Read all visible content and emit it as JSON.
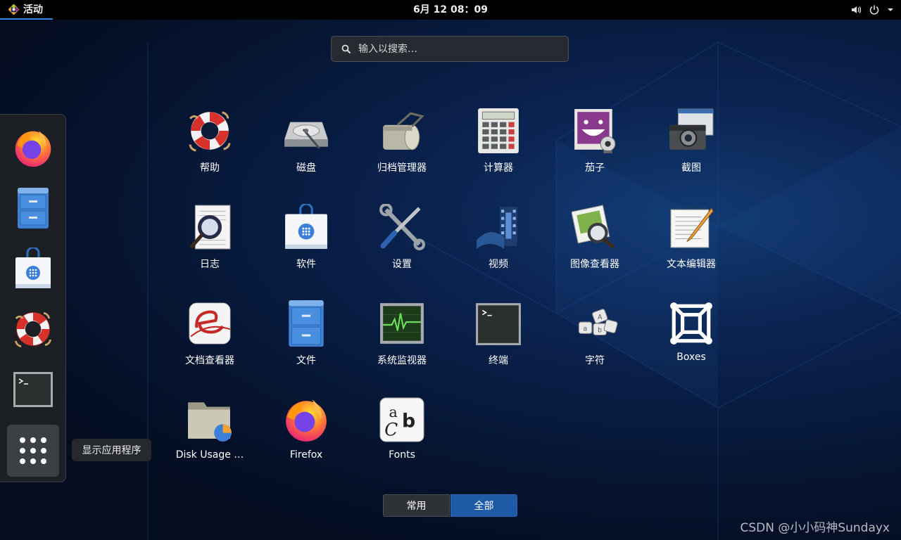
{
  "topbar": {
    "activities_label": "活动",
    "clock": "6月 12  08：09"
  },
  "search": {
    "placeholder": "输入以搜索…"
  },
  "dash": {
    "items": [
      "firefox-icon",
      "files-icon",
      "software-icon",
      "help-icon",
      "terminal-icon",
      "show-apps-icon"
    ],
    "tooltip": "显示应用程序"
  },
  "apps": [
    {
      "label": "帮助",
      "icon": "help-icon"
    },
    {
      "label": "磁盘",
      "icon": "disk-icon"
    },
    {
      "label": "归档管理器",
      "icon": "archive-manager-icon"
    },
    {
      "label": "计算器",
      "icon": "calculator-icon"
    },
    {
      "label": "茄子",
      "icon": "cheese-icon"
    },
    {
      "label": "截图",
      "icon": "screenshot-icon"
    },
    {
      "label": "日志",
      "icon": "logs-icon"
    },
    {
      "label": "软件",
      "icon": "software-icon"
    },
    {
      "label": "设置",
      "icon": "settings-icon"
    },
    {
      "label": "视频",
      "icon": "videos-icon"
    },
    {
      "label": "图像查看器",
      "icon": "image-viewer-icon"
    },
    {
      "label": "文本编辑器",
      "icon": "text-editor-icon"
    },
    {
      "label": "文档查看器",
      "icon": "document-viewer-icon"
    },
    {
      "label": "文件",
      "icon": "files-icon"
    },
    {
      "label": "系统监视器",
      "icon": "system-monitor-icon"
    },
    {
      "label": "终端",
      "icon": "terminal-icon"
    },
    {
      "label": "字符",
      "icon": "characters-icon"
    },
    {
      "label": "Boxes",
      "icon": "boxes-icon"
    },
    {
      "label": "Disk Usage …",
      "icon": "disk-usage-icon"
    },
    {
      "label": "Firefox",
      "icon": "firefox-icon"
    },
    {
      "label": "Fonts",
      "icon": "fonts-icon"
    }
  ],
  "tabs": {
    "frequent": "常用",
    "all": "全部"
  },
  "watermark": "CSDN @小小码神Sundayx",
  "colors": {
    "accent": "#3584e4",
    "active_tab": "#1f5aa6",
    "topbar": "#000000"
  }
}
